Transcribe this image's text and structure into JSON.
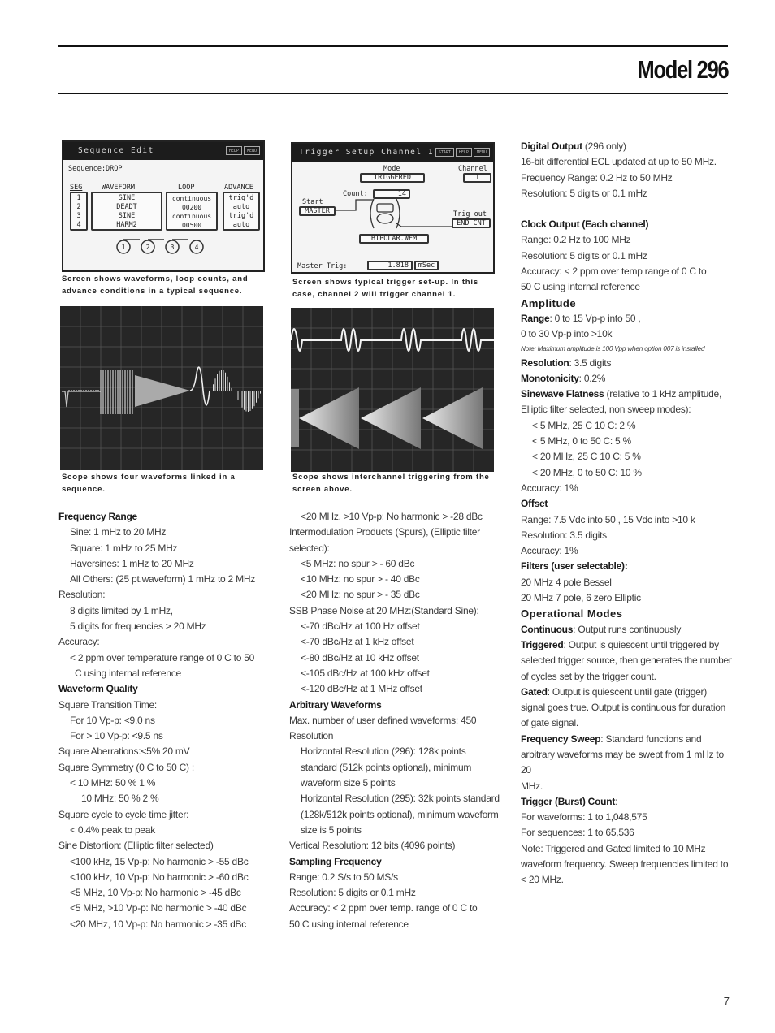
{
  "header": {
    "title": "Model 296"
  },
  "page_number": "7",
  "screen1": {
    "title": "Sequence Edit",
    "buttons": [
      "HELP",
      "MENU"
    ],
    "sequence_label": "Sequence:DROP",
    "col_headers": {
      "seg": "SEG",
      "waveform": "WAVEFORM",
      "loop": "LOOP",
      "advance": "ADVANCE"
    },
    "rows": [
      {
        "seg": "1",
        "waveform": "SINE",
        "loop": "continuous",
        "advance": "trig'd"
      },
      {
        "seg": "2",
        "waveform": "DEADT",
        "loop": "00200",
        "advance": "auto"
      },
      {
        "seg": "3",
        "waveform": "SINE",
        "loop": "continuous",
        "advance": "trig'd"
      },
      {
        "seg": "4",
        "waveform": "HARM2",
        "loop": "00500",
        "advance": "auto"
      }
    ],
    "nodes": [
      "1",
      "2",
      "3",
      "4"
    ],
    "caption": "Screen shows waveforms, loop counts, and advance conditions in a typical sequence."
  },
  "screen2": {
    "title": "Trigger Setup Channel 1",
    "buttons": [
      "START",
      "HELP",
      "MENU"
    ],
    "mode_label": "Mode",
    "mode_value": "TRIGGERED",
    "channel_label": "Channel",
    "channel_value": "1",
    "count_label": "Count:",
    "count_value": "14",
    "start_label": "Start",
    "start_value": "MASTER",
    "trigout_label": "Trig out",
    "trigout_value": "END CNT",
    "waveform_value": "BIPOLAR.WFM",
    "master_label": "Master Trig:",
    "master_value": "1.818",
    "master_unit": "mSec",
    "caption": "Screen shows typical trigger set-up. In this case, channel 2 will trigger channel 1."
  },
  "scope1": {
    "caption": "Scope shows four waveforms linked in a sequence."
  },
  "scope2": {
    "caption": "Scope shows interchannel triggering from the screen above."
  },
  "col1": [
    {
      "t": "Frequency Range",
      "s": "h"
    },
    {
      "t": "Sine: 1 mHz to 20 MHz",
      "s": "in"
    },
    {
      "t": "Square: 1 mHz to 25 MHz",
      "s": "in"
    },
    {
      "t": "Haversines: 1 mHz to 20 MHz",
      "s": "in"
    },
    {
      "t": "All Others: (25 pt.waveform) 1 mHz to 2 MHz",
      "s": "in"
    },
    {
      "t": "Resolution:",
      "s": ""
    },
    {
      "t": "8 digits limited by 1 mHz,",
      "s": "in"
    },
    {
      "t": "5 digits for frequencies > 20 MHz",
      "s": "in"
    },
    {
      "t": "Accuracy:",
      "s": ""
    },
    {
      "t": "<    2 ppm over temperature range of 0   C to   50",
      "s": "in"
    },
    {
      "t": "C using internal reference",
      "s": "in2"
    },
    {
      "t": "Waveform Quality",
      "s": "h"
    },
    {
      "t": "Square Transition Time:",
      "s": ""
    },
    {
      "t": "For    10 Vp-p: <9.0 ns",
      "s": "in"
    },
    {
      "t": "For > 10 Vp-p: <9.5 ns",
      "s": "in"
    },
    {
      "t": "Square Aberrations:<5%    20 mV",
      "s": ""
    },
    {
      "t": "Square Symmetry (0   C to   50   C) :",
      "s": ""
    },
    {
      "t": "< 10 MHz: 50 %    1 %",
      "s": "in"
    },
    {
      "t": "10 MHz: 50 %    2 %",
      "s": "in3"
    },
    {
      "t": "Square cycle to cycle time jitter:",
      "s": ""
    },
    {
      "t": "< 0.4% peak to peak",
      "s": "in"
    },
    {
      "t": "Sine Distortion: (Elliptic filter selected)",
      "s": ""
    },
    {
      "t": "<100 kHz,     15 Vp-p: No harmonic > -55 dBc",
      "s": "in"
    },
    {
      "t": "<100 kHz,     10 Vp-p: No harmonic > -60 dBc",
      "s": "in"
    },
    {
      "t": "<5 MHz,     10 Vp-p: No harmonic > -45 dBc",
      "s": "in"
    },
    {
      "t": "<5 MHz, >10 Vp-p: No harmonic > -40 dBc",
      "s": "in"
    },
    {
      "t": "<20 MHz,     10 Vp-p: No harmonic > -35 dBc",
      "s": "in"
    }
  ],
  "col2": [
    {
      "t": "<20 MHz, >10 Vp-p: No harmonic > -28 dBc",
      "s": "in"
    },
    {
      "t": "Intermodulation Products (Spurs), (Elliptic filter",
      "s": ""
    },
    {
      "t": "selected):",
      "s": ""
    },
    {
      "t": "<5 MHz: no spur > - 60 dBc",
      "s": "in"
    },
    {
      "t": "<10 MHz: no spur > - 40 dBc",
      "s": "in"
    },
    {
      "t": "<20 MHz: no spur > - 35 dBc",
      "s": "in"
    },
    {
      "t": "SSB Phase Noise at 20 MHz:(Standard Sine):",
      "s": ""
    },
    {
      "t": "<-70 dBc/Hz at 100 Hz offset",
      "s": "in"
    },
    {
      "t": "<-70 dBc/Hz at 1 kHz offset",
      "s": "in"
    },
    {
      "t": "<-80 dBc/Hz at 10 kHz offset",
      "s": "in"
    },
    {
      "t": "<-105 dBc/Hz at 100 kHz offset",
      "s": "in"
    },
    {
      "t": "<-120 dBc/Hz at 1 MHz offset",
      "s": "in"
    },
    {
      "t": "Arbitrary Waveforms",
      "s": "h"
    },
    {
      "t": "Max. number of user defined waveforms: 450",
      "s": ""
    },
    {
      "t": "Resolution",
      "s": ""
    },
    {
      "t": "Horizontal Resolution (296): 128k points",
      "s": "in"
    },
    {
      "t": "standard (512k points optional), minimum",
      "s": "in"
    },
    {
      "t": "waveform size 5 points",
      "s": "in"
    },
    {
      "t": "Horizontal Resolution (295): 32k points standard",
      "s": "in"
    },
    {
      "t": "(128k/512k points optional), minimum waveform",
      "s": "in"
    },
    {
      "t": "size is 5 points",
      "s": "in"
    },
    {
      "t": "Vertical Resolution: 12 bits (4096 points)",
      "s": ""
    },
    {
      "t": "Sampling Frequency",
      "s": "h"
    },
    {
      "t": "Range: 0.2 S/s to 50 MS/s",
      "s": ""
    },
    {
      "t": "Resolution: 5 digits or 0.1 mHz",
      "s": ""
    },
    {
      "t": "Accuracy: <    2 ppm over temp. range of 0  C to",
      "s": ""
    },
    {
      "t": "50  C using internal reference",
      "s": ""
    }
  ],
  "col3": [
    {
      "b": "Digital Output",
      "t": " (296 only)",
      "s": ""
    },
    {
      "t": "16-bit differential ECL updated at up to 50 MHz.",
      "s": ""
    },
    {
      "t": "Frequency Range: 0.2 Hz to 50 MHz",
      "s": ""
    },
    {
      "t": "Resolution: 5 digits or 0.1 mHz",
      "s": ""
    },
    {
      "t": "",
      "s": "gap"
    },
    {
      "t": "Clock Output (Each channel)",
      "s": "h"
    },
    {
      "t": "Range: 0.2 Hz to 100 MHz",
      "s": ""
    },
    {
      "t": "Resolution: 5 digits or 0.1 mHz",
      "s": ""
    },
    {
      "t": "Accuracy: <    2 ppm over temp range of 0   C to",
      "s": ""
    },
    {
      "t": "50   C using internal reference",
      "s": ""
    },
    {
      "t": "Amplitude",
      "s": "h2"
    },
    {
      "b": "Range",
      "t": ": 0 to 15 Vp-p into 50    ,",
      "s": ""
    },
    {
      "t": " 0 to 30 Vp-p into >10k",
      "s": ""
    },
    {
      "t": "Note: Maximum amplitude is 100 Vpp when option 007 is installed",
      "s": "note"
    },
    {
      "b": "Resolution",
      "t": ": 3.5 digits",
      "s": ""
    },
    {
      "b": "Monotonicity",
      "t": ": 0.2%",
      "s": ""
    },
    {
      "b": "Sinewave Flatness",
      "t": " (relative to 1 kHz amplitude,",
      "s": ""
    },
    {
      "t": "Elliptic filter selected, non sweep modes):",
      "s": ""
    },
    {
      "t": "< 5 MHz, 25  C    10  C:    2 %",
      "s": "in"
    },
    {
      "t": "< 5 MHz, 0 to 50  C:    5 %",
      "s": "in"
    },
    {
      "t": "< 20 MHz, 25  C    10  C:    5 %",
      "s": "in"
    },
    {
      "t": "< 20 MHz, 0 to 50  C:    10 %",
      "s": "in"
    },
    {
      "t": "Accuracy:   1%",
      "s": ""
    },
    {
      "t": "Offset",
      "s": "h"
    },
    {
      "t": "Range:   7.5 Vdc into 50    ,    15 Vdc into >10 k",
      "s": ""
    },
    {
      "t": "Resolution: 3.5 digits",
      "s": ""
    },
    {
      "t": "Accuracy:   1%",
      "s": ""
    },
    {
      "t": "Filters (user selectable):",
      "s": "h"
    },
    {
      "t": "20 MHz 4 pole Bessel",
      "s": ""
    },
    {
      "t": "20 MHz 7 pole, 6 zero Elliptic",
      "s": ""
    },
    {
      "t": "Operational Modes",
      "s": "h2"
    },
    {
      "b": "Continuous",
      "t": ": Output runs continuously",
      "s": ""
    },
    {
      "b": "Triggered",
      "t": ": Output is quiescent until triggered by",
      "s": ""
    },
    {
      "t": "selected trigger source, then generates the number",
      "s": ""
    },
    {
      "t": "of cycles set by the trigger count.",
      "s": ""
    },
    {
      "b": "Gated",
      "t": ": Output is quiescent until gate (trigger)",
      "s": ""
    },
    {
      "t": "signal goes true. Output is continuous for duration",
      "s": ""
    },
    {
      "t": "of gate signal.",
      "s": ""
    },
    {
      "b": "Frequency Sweep",
      "t": ": Standard functions and",
      "s": ""
    },
    {
      "t": "arbitrary waveforms may be swept from 1 mHz to 20",
      "s": ""
    },
    {
      "t": "MHz.",
      "s": ""
    },
    {
      "b": "Trigger (Burst) Count",
      "t": ":",
      "s": ""
    },
    {
      "t": "For waveforms: 1 to 1,048,575",
      "s": ""
    },
    {
      "t": "For sequences: 1 to 65,536",
      "s": ""
    },
    {
      "t": "Note: Triggered and Gated limited to 10 MHz",
      "s": ""
    },
    {
      "t": "waveform frequency. Sweep frequencies limited to",
      "s": ""
    },
    {
      "t": "< 20 MHz.",
      "s": ""
    }
  ]
}
